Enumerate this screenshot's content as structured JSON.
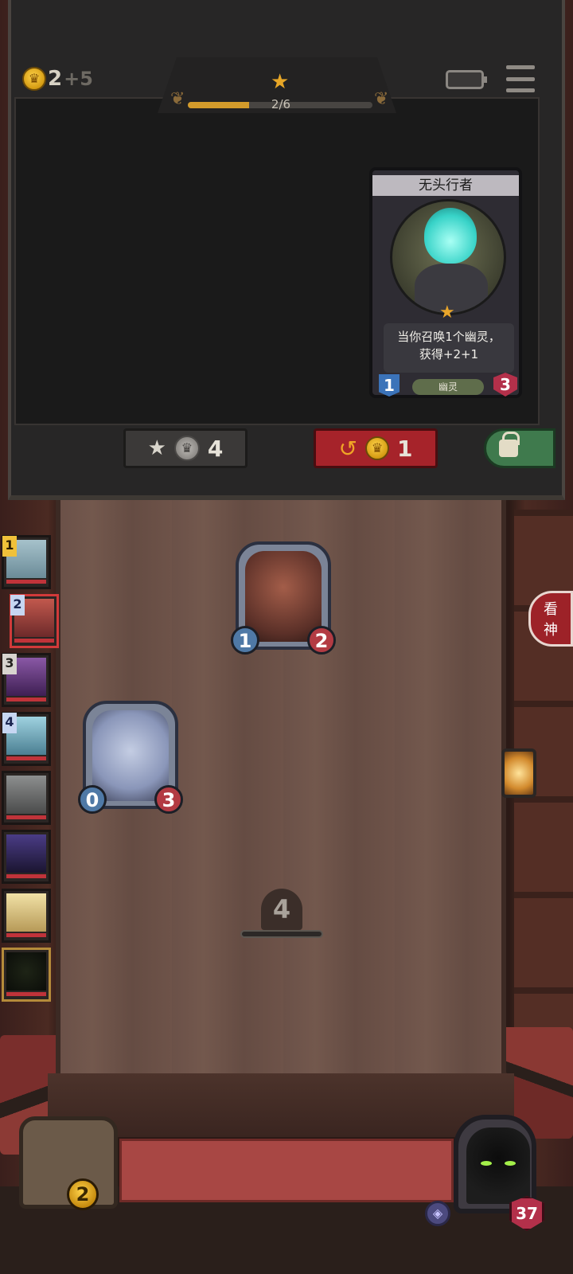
{
  "gold": {
    "value": "2",
    "plus": "+5",
    "icon": "crown-coin-icon"
  },
  "tier": {
    "progress_text": "2/6",
    "progress": 0.33
  },
  "card": {
    "name": "无头行者",
    "desc_line1": "当你召唤1个幽灵，",
    "desc_line2": "获得+2+1",
    "attack": "1",
    "health": "3",
    "tribe": "幽灵"
  },
  "shop_buttons": {
    "upgrade_cost": "4",
    "refresh_cost": "1"
  },
  "board": {
    "units": [
      {
        "attack": "1",
        "health": "2",
        "name": "warrior-unit",
        "color": "#8a4a3a"
      },
      {
        "attack": "0",
        "health": "3",
        "name": "ghost-gnome-unit",
        "color": "#9aa6c9"
      }
    ],
    "turn": "4"
  },
  "roster": [
    {
      "rank": "1",
      "style": "gold",
      "color": "#7c9aa8"
    },
    {
      "rank": "2",
      "style": "blue",
      "color": "#9b3a3a",
      "active": true
    },
    {
      "rank": "3",
      "style": "grey",
      "color": "#6a3e82"
    },
    {
      "rank": "4",
      "style": "blue",
      "color": "#6aa0b8"
    },
    {
      "rank": "",
      "style": "",
      "color": "#6f7070"
    },
    {
      "rank": "",
      "style": "",
      "color": "#2e2650"
    },
    {
      "rank": "",
      "style": "",
      "color": "#d8c48a"
    },
    {
      "rank": "",
      "style": "",
      "color": "#161a12"
    }
  ],
  "side_button": {
    "line1": "看",
    "line2": "神"
  },
  "hud": {
    "coins": "2",
    "hero_health": "37"
  },
  "colors": {
    "gold": "#e6a627",
    "refresh": "#a6232a",
    "lock": "#3f7a4d"
  }
}
